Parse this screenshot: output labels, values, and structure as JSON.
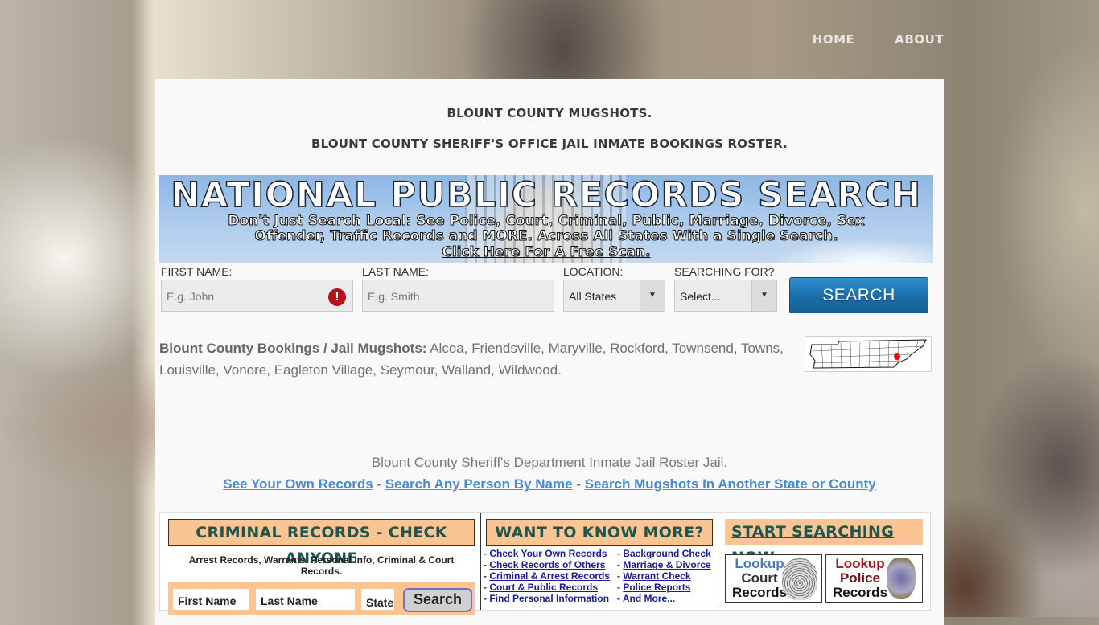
{
  "nav": {
    "home": "HOME",
    "about": "ABOUT"
  },
  "header": {
    "title": "BLOUNT COUNTY MUGSHOTS.",
    "subtitle": "BLOUNT COUNTY SHERIFF'S OFFICE JAIL INMATE BOOKINGS ROSTER."
  },
  "banner": {
    "title": "NATIONAL PUBLIC RECORDS SEARCH",
    "line1": "Don't Just Search Local: See Police, Court, Criminal, Public, Marriage, Divorce, Sex",
    "line2": "Offender, Traffic Records and MORE. Across All States With a Single Search.",
    "cta": "Click Here For A Free Scan."
  },
  "search_form": {
    "first_name_label": "FIRST NAME:",
    "first_name_placeholder": "E.g. John",
    "first_name_error_icon": "!",
    "last_name_label": "LAST NAME:",
    "last_name_placeholder": "E.g. Smith",
    "location_label": "LOCATION:",
    "location_value": "All States",
    "searching_for_label": "SEARCHING FOR?",
    "searching_for_value": "Select...",
    "caret": "▼",
    "submit": "SEARCH"
  },
  "towns": {
    "label": "Blount County Bookings / Jail Mugshots:",
    "list": " Alcoa, Friendsville, Maryville, Rockford, Townsend, Towns, Louisville, Vonore, Eagleton Village, Seymour, Walland, Wildwood."
  },
  "description": "Blount County Sheriff's Department Inmate Jail Roster Jail.",
  "links": {
    "own_records": "See Your Own Records",
    "sep": " - ",
    "any_person": "Search Any Person By Name",
    "other_state": "Search Mugshots In Another State or County"
  },
  "ads": {
    "criminal": {
      "title": "CRIMINAL RECORDS - CHECK ANYONE",
      "desc": "Arrest Records, Warrants, Personal Info, Criminal & Court Records.",
      "first_name": "First Name",
      "last_name": "Last Name",
      "state": "State",
      "button": "Search"
    },
    "more": {
      "title": "WANT TO KNOW MORE?",
      "left": [
        "Check Your Own Records",
        "Check Records of Others",
        "Criminal & Arrest Records",
        "Court & Public Records",
        "Find Personal Information"
      ],
      "right": [
        "Background Check",
        "Marriage & Divorce",
        "Warrant Check",
        "Police Reports",
        "And More..."
      ]
    },
    "start": {
      "title": "START SEARCHING NOW",
      "court": {
        "line1": "Lookup",
        "line2": "Court",
        "line3": "Records"
      },
      "police": {
        "line1": "Lookup",
        "line2": "Police",
        "line3": "Records"
      }
    }
  },
  "colors": {
    "link_blue": "#4a8ad0",
    "search_button": "#1a6ea9",
    "ad_peach": "#fbc493",
    "ad_heading": "#1e5750",
    "error_red": "#b5121b",
    "map_marker": "#ff0000"
  }
}
